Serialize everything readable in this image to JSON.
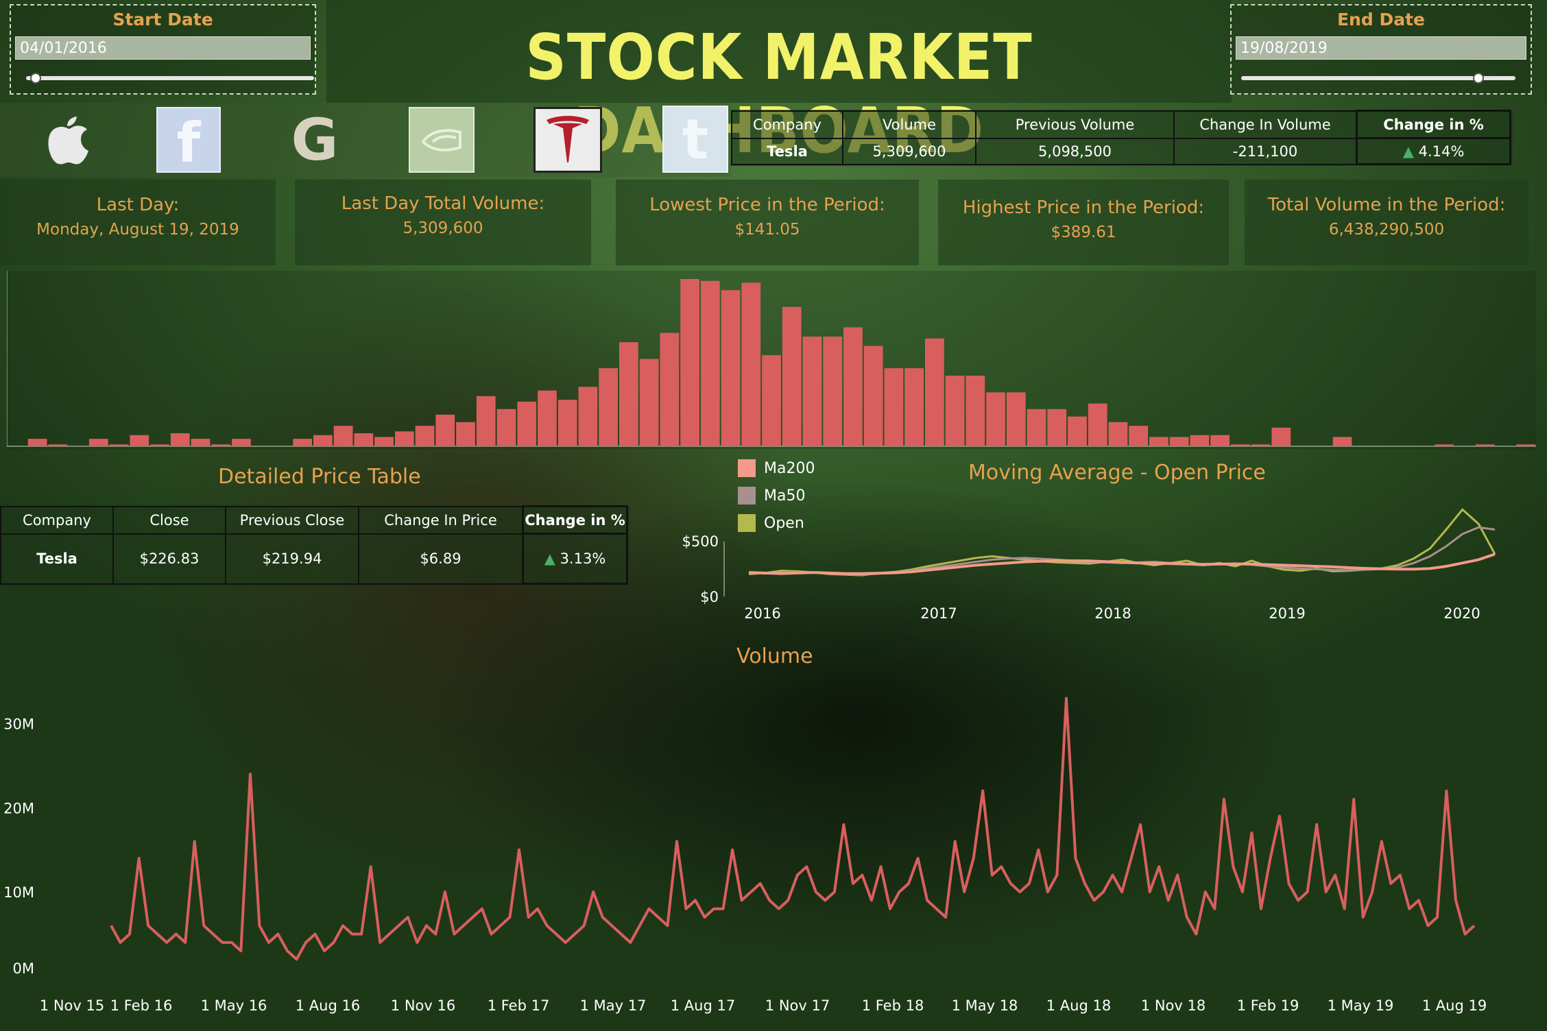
{
  "start_date": {
    "label": "Start Date",
    "value": "04/01/2016",
    "slider_fraction": 0.0
  },
  "end_date": {
    "label": "End Date",
    "value": "19/08/2019",
    "slider_fraction": 0.85
  },
  "title": "STOCK MARKET DASHBOARD",
  "companies": [
    {
      "name": "apple-logo",
      "icon": "apple-icon"
    },
    {
      "name": "facebook-logo",
      "icon": "facebook-icon",
      "glyph": "f"
    },
    {
      "name": "google-logo",
      "icon": "google-icon",
      "glyph": "G"
    },
    {
      "name": "nvidia-logo",
      "icon": "nvidia-icon"
    },
    {
      "name": "tesla-logo",
      "icon": "tesla-icon",
      "glyph": "T",
      "selected": true
    },
    {
      "name": "twitter-logo",
      "icon": "twitter-icon",
      "glyph": "t"
    }
  ],
  "volume_table": {
    "headers": [
      "Company",
      "Volume",
      "Previous Volume",
      "Change In Volume",
      "Change in %"
    ],
    "row": [
      "Tesla",
      "5,309,600",
      "5,098,500",
      "-211,100",
      "4.14%"
    ]
  },
  "kpis": [
    {
      "label": "Last Day:",
      "value": "Monday, August 19, 2019"
    },
    {
      "label": "Last Day Total Volume:",
      "value": "5,309,600"
    },
    {
      "label": "Lowest Price in the Period:",
      "value": "$141.05"
    },
    {
      "label": "Highest Price in the Period:",
      "value": "$389.61"
    },
    {
      "label": "Total Volume in the Period:",
      "value": "6,438,290,500"
    }
  ],
  "price_table": {
    "title": "Detailed Price Table",
    "headers": [
      "Company",
      "Close",
      "Previous Close",
      "Change In Price",
      "Change in %"
    ],
    "row": [
      "Tesla",
      "$226.83",
      "$219.94",
      "$6.89",
      "3.13%"
    ]
  },
  "colors": {
    "accent": "#e6a24f",
    "title": "#f2f26a",
    "bar": "#d95f5f",
    "ma200": "#f39a8a",
    "ma50": "#a8908e",
    "open": "#b5b84c",
    "up": "#46b36a"
  },
  "chart_data": [
    {
      "type": "bar",
      "description_key": "distribution",
      "values": [
        0,
        4,
        1,
        0,
        4,
        1,
        6,
        1,
        7,
        4,
        1,
        4,
        0,
        0,
        4,
        6,
        11,
        7,
        5,
        8,
        11,
        17,
        13,
        27,
        20,
        24,
        30,
        25,
        32,
        42,
        56,
        47,
        61,
        90,
        89,
        84,
        88,
        49,
        75,
        59,
        59,
        64,
        54,
        42,
        42,
        58,
        38,
        38,
        29,
        29,
        20,
        20,
        16,
        23,
        13,
        11,
        5,
        5,
        6,
        6,
        1,
        1,
        10,
        0,
        0,
        5,
        0,
        0,
        0,
        0,
        1,
        0,
        1,
        0,
        1
      ]
    },
    {
      "type": "line",
      "title": "Moving Average - Open Price",
      "x_ticks": [
        "2016",
        "2017",
        "2018",
        "2019",
        "2020"
      ],
      "y_ticks": [
        "$500",
        "$0"
      ],
      "ylim": [
        0,
        800
      ],
      "series": [
        {
          "name": "Ma200",
          "values": [
            215,
            210,
            205,
            210,
            215,
            210,
            205,
            205,
            208,
            212,
            220,
            235,
            250,
            265,
            280,
            290,
            300,
            310,
            315,
            320,
            320,
            318,
            312,
            305,
            300,
            298,
            295,
            290,
            288,
            290,
            292,
            290,
            285,
            280,
            275,
            270,
            265,
            258,
            252,
            248,
            245,
            245,
            250,
            270,
            300,
            330,
            380
          ]
        },
        {
          "name": "Ma50",
          "values": [
            210,
            205,
            215,
            218,
            215,
            205,
            200,
            195,
            205,
            215,
            230,
            250,
            270,
            290,
            310,
            330,
            340,
            345,
            338,
            330,
            320,
            310,
            305,
            300,
            305,
            310,
            300,
            290,
            280,
            290,
            295,
            285,
            270,
            260,
            250,
            245,
            238,
            235,
            240,
            245,
            260,
            300,
            360,
            450,
            560,
            620,
            600
          ]
        },
        {
          "name": "Open",
          "values": [
            200,
            210,
            230,
            225,
            215,
            200,
            195,
            190,
            210,
            220,
            240,
            270,
            295,
            320,
            345,
            360,
            345,
            330,
            315,
            305,
            300,
            295,
            310,
            330,
            300,
            280,
            300,
            320,
            280,
            300,
            270,
            320,
            270,
            240,
            230,
            250,
            225,
            230,
            240,
            250,
            280,
            340,
            430,
            600,
            780,
            650,
            380
          ]
        }
      ]
    },
    {
      "type": "line",
      "title": "Volume",
      "x_ticks": [
        "1 Nov 15",
        "1 Feb 16",
        "1 May 16",
        "1 Aug 16",
        "1 Nov 16",
        "1 Feb 17",
        "1 May 17",
        "1 Aug 17",
        "1 Nov 17",
        "1 Feb 18",
        "1 May 18",
        "1 Aug 18",
        "1 Nov 18",
        "1 Feb 19",
        "1 May 19",
        "1 Aug 19"
      ],
      "y_ticks": [
        "30M",
        "20M",
        "10M",
        "0M"
      ],
      "ylim": [
        0,
        35
      ],
      "series": [
        {
          "name": "Volume",
          "values": [
            6,
            4,
            5,
            14,
            6,
            5,
            4,
            5,
            4,
            16,
            6,
            5,
            4,
            4,
            3,
            24,
            6,
            4,
            5,
            3,
            2,
            4,
            5,
            3,
            4,
            6,
            5,
            5,
            13,
            4,
            5,
            6,
            7,
            4,
            6,
            5,
            10,
            5,
            6,
            7,
            8,
            5,
            6,
            7,
            15,
            7,
            8,
            6,
            5,
            4,
            5,
            6,
            10,
            7,
            6,
            5,
            4,
            6,
            8,
            7,
            6,
            16,
            8,
            9,
            7,
            8,
            8,
            15,
            9,
            10,
            11,
            9,
            8,
            9,
            12,
            13,
            10,
            9,
            10,
            18,
            11,
            12,
            9,
            13,
            8,
            10,
            11,
            14,
            9,
            8,
            7,
            16,
            10,
            14,
            22,
            12,
            13,
            11,
            10,
            11,
            15,
            10,
            12,
            33,
            14,
            11,
            9,
            10,
            12,
            10,
            14,
            18,
            10,
            13,
            9,
            12,
            7,
            5,
            10,
            8,
            21,
            13,
            10,
            17,
            8,
            14,
            19,
            11,
            9,
            10,
            18,
            10,
            12,
            8,
            21,
            7,
            10,
            16,
            11,
            12,
            8,
            9,
            6,
            7,
            22,
            9,
            5,
            6
          ]
        }
      ]
    }
  ]
}
